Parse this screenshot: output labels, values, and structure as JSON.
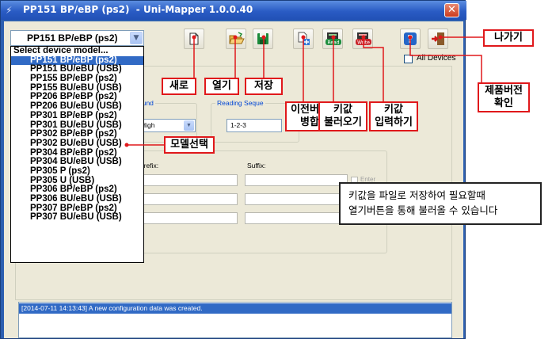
{
  "window": {
    "title": "PP151 BP/eBP (ps2)  - Uni-Mapper 1.0.0.40",
    "close_glyph": "✕"
  },
  "model_select": {
    "value": "PP151 BP/eBP (ps2)",
    "options": [
      "Select device model...",
      "PP151 BP/eBP (ps2)",
      "PP151 BU/eBU (USB)",
      "PP155 BP/eBP (ps2)",
      "PP155 BU/eBU (USB)",
      "PP206 BP/eBP (ps2)",
      "PP206 BU/eBU (USB)",
      "PP301 BP/eBP (ps2)",
      "PP301 BU/eBU (USB)",
      "PP302 BP/eBP (ps2)",
      "PP302 BU/eBU (USB)",
      "PP304 BP/eBP (ps2)",
      "PP304 BU/eBU (USB)",
      "PP305 P (ps2)",
      "PP305 U (USB)",
      "PP306 BP/eBP (ps2)",
      "PP306 BU/eBU (USB)",
      "PP307 BP/eBP (ps2)",
      "PP307 BU/eBU (USB)"
    ],
    "selected_index": 1
  },
  "toolbar": {
    "icons": [
      "new-file-icon",
      "open-folder-icon",
      "save-icon",
      "merge-previous-icon",
      "read-key-icon",
      "write-key-icon",
      "help-icon",
      "exit-icon"
    ],
    "read_label": "Read",
    "write_label": "Write",
    "help_glyph": "?"
  },
  "all_devices": {
    "label": "All Devices",
    "checked": false
  },
  "settings": {
    "sound_group_title": "ound",
    "sound_value": "High",
    "reading_group_title": "Reading Seque",
    "reading_value": "1-2-3",
    "prefix_group_title": "x",
    "prefix_label": "Prefix:",
    "suffix_label": "Suffix:",
    "enter_label": "Enter"
  },
  "log": {
    "line": "[2014-07-11 14:13:43] A new configuration data was created."
  },
  "annotations": {
    "new": "새로",
    "open": "열기",
    "save": "저장",
    "merge_line1": "이전버전",
    "merge_line2": "병합",
    "read_line1": "키값",
    "read_line2": "불러오기",
    "write_line1": "키값",
    "write_line2": "입력하기",
    "exit": "나가기",
    "version_line1": "제품버전",
    "version_line2": "확인",
    "model_select": "모델선택",
    "info_line1": "키값을 파일로 저장하여 필요할때",
    "info_line2": "열기버튼을 통해 불러올 수 있습니다"
  },
  "colors": {
    "callout_border": "#e0181b",
    "selection": "#316ac5",
    "titlebar": "#2a5cc4"
  }
}
